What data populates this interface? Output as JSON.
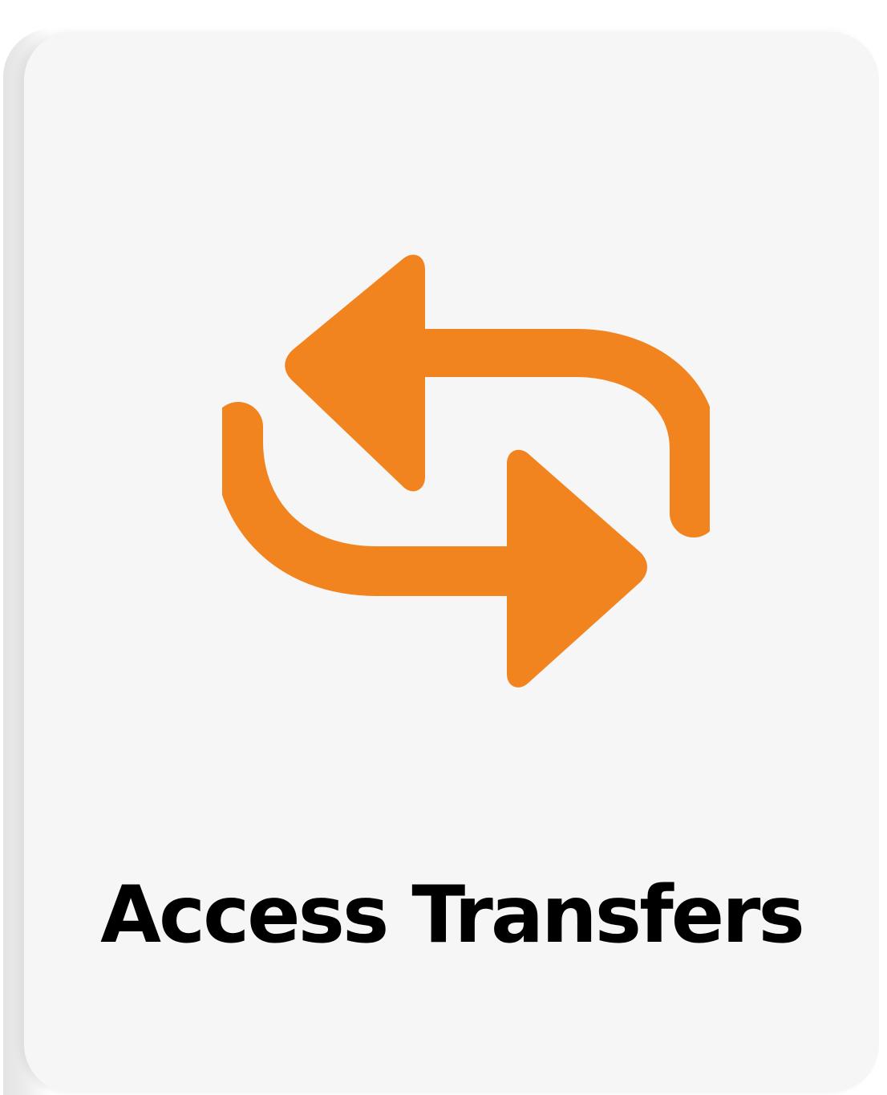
{
  "tile": {
    "label": "Access Transfers",
    "icon": "transfer-arrows-icon"
  },
  "colors": {
    "accent": "#f2841f",
    "card_background": "#f6f6f6",
    "label_text": "#000000"
  }
}
